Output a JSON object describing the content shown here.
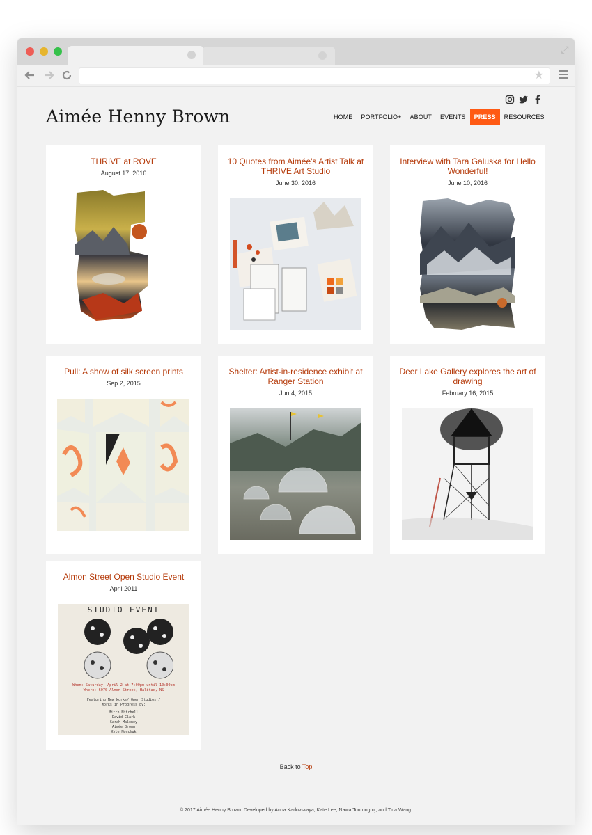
{
  "site": {
    "title": "Aimée Henny Brown",
    "nav": [
      {
        "label": "HOME",
        "active": false
      },
      {
        "label": "PORTFOLIO+",
        "active": false
      },
      {
        "label": "ABOUT",
        "active": false
      },
      {
        "label": "EVENTS",
        "active": false
      },
      {
        "label": "PRESS",
        "active": true
      },
      {
        "label": "RESOURCES",
        "active": false
      }
    ],
    "social": [
      "instagram-icon",
      "twitter-icon",
      "facebook-icon"
    ],
    "accent": "#ff5a14",
    "title_color": "#b53a0a"
  },
  "posts": [
    {
      "title": "THRIVE at ROVE",
      "date": "August 17, 2016"
    },
    {
      "title": "10 Quotes from Aimée's Artist Talk at THRIVE Art Studio",
      "date": "June 30, 2016"
    },
    {
      "title": "Interview with Tara Galuska for Hello Wonderful!",
      "date": "June 10, 2016"
    },
    {
      "title": "Pull: A show of silk screen prints",
      "date": "Sep 2, 2015"
    },
    {
      "title": "Shelter: Artist-in-residence exhibit at Ranger Station",
      "date": "Jun 4, 2015"
    },
    {
      "title": "Deer Lake Gallery explores the art of drawing",
      "date": "February 16, 2015"
    },
    {
      "title": "Almon Street Open Studio Event",
      "date": "April 2011"
    }
  ],
  "poster": {
    "heading": "STUDIO EVENT",
    "line1": "When: Saturday, April 2 at 7:00pm until 10:00pm",
    "line2": "Where: 6070 Almon Street, Halifax, NS",
    "line3": "Featuring New Works/ Open Studios /",
    "line4": "Works in Progress by:",
    "names": [
      "Mitch Mitchell",
      "David Clark",
      "Sarah Maloney",
      "Aimée Brown",
      "Kyle Monchuk"
    ]
  },
  "back_to_top": {
    "prefix": "Back to",
    "link": "Top"
  },
  "footer": "© 2017 Aimée Henny Brown. Developed by Anna Karlovskaya, Kate Lee, Nawa Tonrungroj, and Tina Wang."
}
